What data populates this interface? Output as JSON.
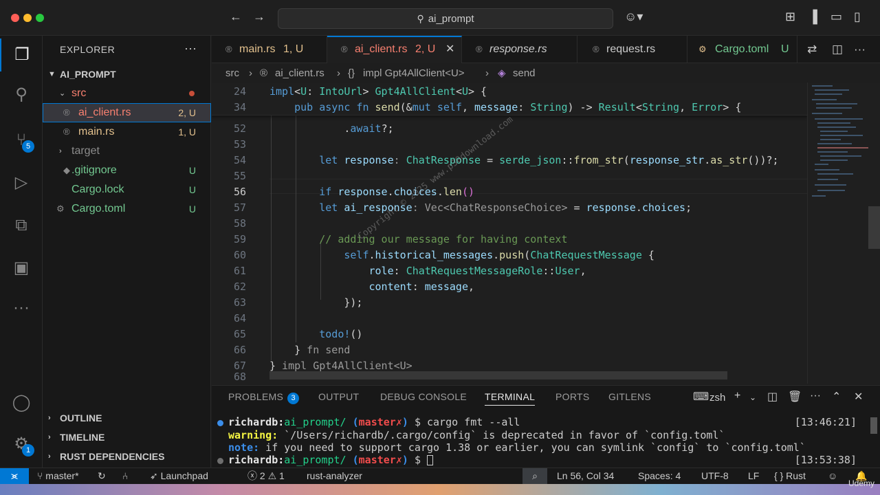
{
  "window": {
    "search_text": "ai_prompt",
    "icons": [
      "back-arrow",
      "forward-arrow",
      "copilot",
      "layout-sidebar-left",
      "layout-panel",
      "layout-sidebar-right",
      "customize-layout"
    ]
  },
  "activity_bar": {
    "items": [
      "explorer",
      "search",
      "source-control",
      "run-debug",
      "extensions",
      "remote-explorer",
      "more"
    ],
    "source_control_badge": "5",
    "settings_badge": "1"
  },
  "sidebar": {
    "title": "EXPLORER",
    "more": "···",
    "project": "AI_PROMPT",
    "tree": [
      {
        "name": "src",
        "type": "folder",
        "open": true,
        "status": "",
        "level": 1
      },
      {
        "name": "ai_client.rs",
        "type": "file",
        "status": "2, U",
        "level": 2,
        "selected": true
      },
      {
        "name": "main.rs",
        "type": "file",
        "status": "1, U",
        "level": 2
      },
      {
        "name": "target",
        "type": "folder",
        "open": false,
        "status": "",
        "level": 1
      },
      {
        "name": ".gitignore",
        "type": "file",
        "status": "U",
        "level": 1
      },
      {
        "name": "Cargo.lock",
        "type": "file",
        "status": "U",
        "level": 1
      },
      {
        "name": "Cargo.toml",
        "type": "file",
        "status": "U",
        "level": 1
      }
    ],
    "sections": [
      "OUTLINE",
      "TIMELINE",
      "RUST DEPENDENCIES"
    ]
  },
  "tabs": [
    {
      "label": "main.rs",
      "status": "1, U"
    },
    {
      "label": "ai_client.rs",
      "status": "2, U",
      "active": true,
      "close": "✕"
    },
    {
      "label": "response.rs",
      "status": ""
    },
    {
      "label": "request.rs",
      "status": ""
    },
    {
      "label": "Cargo.toml",
      "status": "U"
    }
  ],
  "breadcrumb": {
    "folder": "src",
    "file": "ai_client.rs",
    "impl": "impl Gpt4AllClient<U>",
    "method": "send",
    "sep": "›"
  },
  "editor": {
    "line_numbers": [
      "24",
      "34",
      "52",
      "53",
      "54",
      "55",
      "56",
      "57",
      "58",
      "59",
      "60",
      "61",
      "62",
      "63",
      "64",
      "65",
      "66",
      "67",
      "68"
    ],
    "watermark": "Copyright © 2025 www.p30download.com"
  },
  "panel": {
    "tabs": [
      "PROBLEMS",
      "OUTPUT",
      "DEBUG CONSOLE",
      "TERMINAL",
      "PORTS",
      "GITLENS"
    ],
    "problems_count": "3",
    "shell": "zsh",
    "terminal": {
      "user": "richardb:",
      "dir": "ai_prompt/",
      "branch_open": "(",
      "branch": "master✗",
      "branch_close": ")",
      "prompt": "$",
      "command": "cargo fmt --all",
      "time1": "[13:46:21]",
      "warning_label": "warning:",
      "warning_text": " `/Users/richardb/.cargo/config` is deprecated in favor of `config.toml`",
      "note_label": "note:",
      "note_text": " if you need to support cargo 1.38 or earlier, you can symlink `config` to `config.toml`",
      "time2": "[13:53:38]"
    }
  },
  "statusbar": {
    "branch": "master*",
    "launchpad": "Launchpad",
    "errors": "2",
    "warnings": "1",
    "analyzer": "rust-analyzer",
    "position": "Ln 56, Col 34",
    "spaces": "Spaces: 4",
    "encoding": "UTF-8",
    "eol": "LF",
    "language": "Rust",
    "language_prefix": "{ }"
  },
  "overlay": {
    "udemy": "Udemy"
  },
  "colors": {
    "accent": "#0078d4",
    "modified": "#e2c08d",
    "untracked": "#73c991",
    "error": "#f14c4c"
  }
}
